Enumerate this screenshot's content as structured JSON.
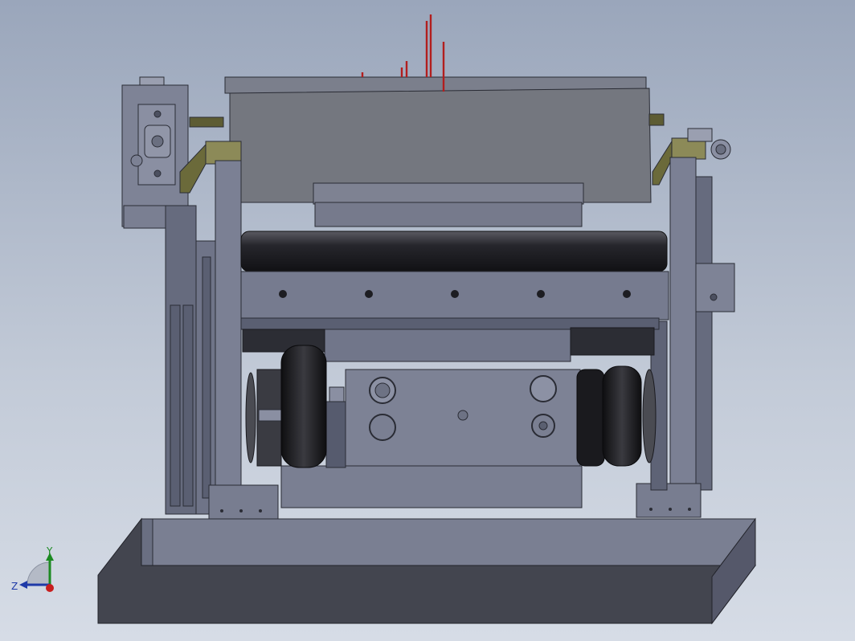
{
  "viewport": {
    "background_top": "#9aa6bb",
    "background_bottom": "#d6dce6",
    "part_color": "#6f7488",
    "roller_color": "#1d1d22",
    "pin_color": "#b21e1e",
    "accent_color": "#6b6a3a"
  },
  "triad": {
    "y_label": "Y",
    "z_label": "Z",
    "y_color": "#1c8a22",
    "z_color": "#1f3aa8",
    "x_color": "#c81e1e"
  }
}
